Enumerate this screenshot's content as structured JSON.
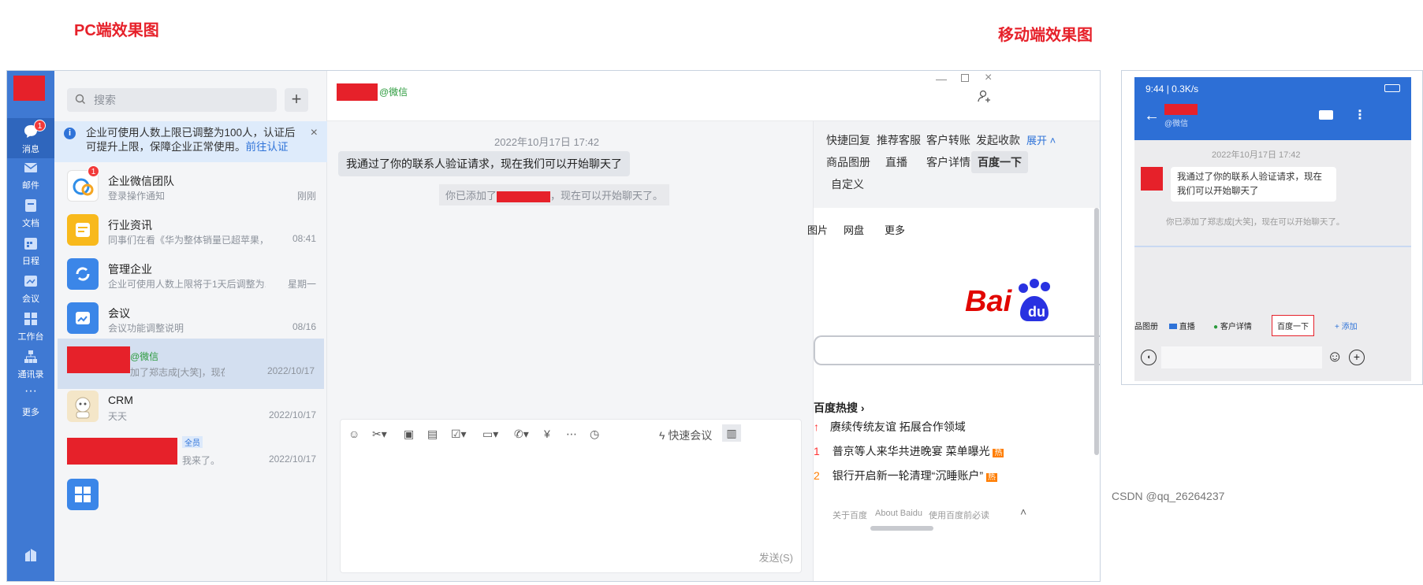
{
  "captions": {
    "pc": "PC端效果图",
    "mobile": "移动端效果图"
  },
  "watermark": "CSDN @qq_26264237",
  "rail": {
    "items": [
      {
        "label": "消息",
        "icon": "chat-icon"
      },
      {
        "label": "邮件",
        "icon": "mail-icon"
      },
      {
        "label": "文档",
        "icon": "doc-icon"
      },
      {
        "label": "日程",
        "icon": "calendar-icon"
      },
      {
        "label": "会议",
        "icon": "meeting-icon"
      },
      {
        "label": "工作台",
        "icon": "grid-icon"
      },
      {
        "label": "通讯录",
        "icon": "contacts-icon"
      },
      {
        "label": "更多",
        "icon": "more-icon"
      }
    ],
    "message_badge": "1"
  },
  "search": {
    "placeholder": "搜索"
  },
  "notice": {
    "text": "企业可使用人数上限已调整为100人，认证后可提升上限，保障企业正常使用。",
    "link": "前往认证"
  },
  "conversations": [
    {
      "title": "企业微信团队",
      "subtitle": "登录操作通知",
      "time": "刚刚",
      "badge": "1",
      "color": "#ffffff"
    },
    {
      "title": "行业资讯",
      "subtitle": "同事们在看《华为整体销量已超苹果，...",
      "time": "08:41",
      "color": "#f8b91c"
    },
    {
      "title": "管理企业",
      "subtitle": "企业可使用人数上限将于1天后调整为...",
      "time": "星期一",
      "color": "#3b86e8"
    },
    {
      "title": "会议",
      "subtitle": "会议功能调整说明",
      "time": "08/16",
      "color": "#3b86e8"
    },
    {
      "title": "@微信",
      "subtitle": "加了郑志成[大笑]，现在...",
      "time": "2022/10/17",
      "color": "#e6212a"
    },
    {
      "title": "CRM",
      "subtitle": "天天",
      "time": "2022/10/17",
      "color": "#f4e6c8"
    },
    {
      "title": "全员",
      "subtitle": "我来了。",
      "time": "2022/10/17",
      "color": "#e6212a"
    }
  ],
  "chat": {
    "header_tag": "@微信",
    "timestamp": "2022年10月17日 17:42",
    "message": "我通过了你的联系人验证请求，现在我们可以开始聊天了",
    "system_prefix": "你已添加了",
    "system_suffix": "，现在可以开始聊天了。",
    "quick_meeting": "快速会议",
    "send": "发送(S)"
  },
  "quick_replies": {
    "row1": [
      "快捷回复",
      "推荐客服",
      "客户转账",
      "发起收款"
    ],
    "expand": "展开",
    "row2": [
      "商品图册",
      "直播",
      "客户详情",
      "百度一下"
    ],
    "row3": [
      "自定义"
    ]
  },
  "baidu": {
    "nav": [
      "图片",
      "网盘",
      "更多"
    ],
    "logo_text": "Bai",
    "logo_du": "du",
    "hot_title": "百度热搜",
    "hot": [
      {
        "rank": "",
        "text": "赓续传统友谊 拓展合作领域",
        "tag": ""
      },
      {
        "rank": "1",
        "text": "普京等人来华共进晚宴 菜单曝光",
        "tag": "热"
      },
      {
        "rank": "2",
        "text": "银行开启新一轮清理“沉睡账户”",
        "tag": "热"
      }
    ],
    "footer": [
      "关于百度",
      "About Baidu",
      "使用百度前必读"
    ]
  },
  "mobile": {
    "status": "9:44 | 0.3K/s",
    "sub_title": "@微信",
    "timestamp": "2022年10月17日  17:42",
    "message": "我通过了你的联系人验证请求，现在我们可以开始聊天了",
    "system": "你已添加了郑志成[大笑]，现在可以开始聊天了。",
    "tools": [
      "品图册",
      "直播",
      "客户详情",
      "百度一下"
    ],
    "add": "添加"
  }
}
